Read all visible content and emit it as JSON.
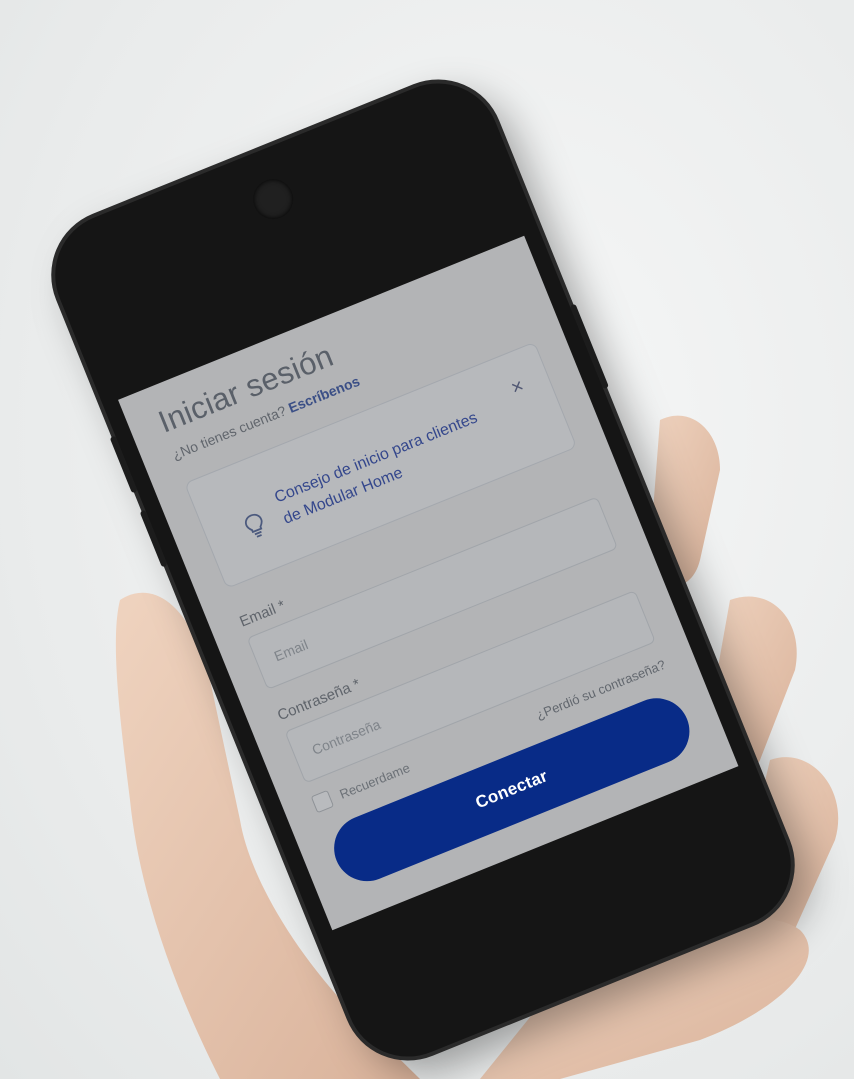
{
  "login": {
    "title": "Iniciar sesión",
    "signup_prompt": "¿No tienes cuenta?",
    "signup_link": "Escríbenos"
  },
  "tip": {
    "text": "Consejo de inicio para clientes de Modular Home",
    "icon": "lightbulb-icon",
    "close_icon": "close-icon",
    "close_label": "×"
  },
  "form": {
    "email_label": "Email *",
    "email_placeholder": "Email",
    "password_label": "Contraseña *",
    "password_placeholder": "Contraseña",
    "remember_label": "Recuerdame",
    "forgot_link": "¿Perdió su contraseña?",
    "submit_label": "Conectar"
  },
  "colors": {
    "primary_button": "#082b87",
    "screen_overlay": "#b3b4b6",
    "link": "#3b4f86"
  }
}
